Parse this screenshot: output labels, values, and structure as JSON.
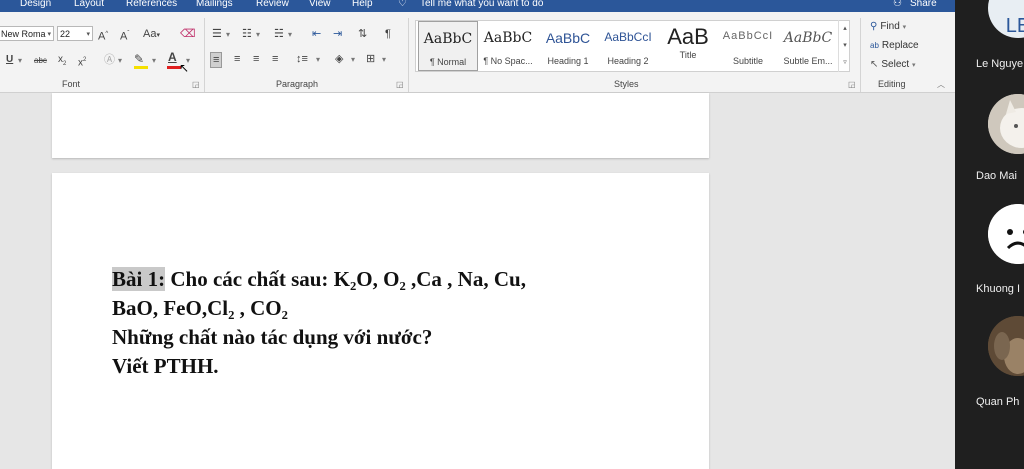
{
  "menu": [
    "Design",
    "Layout",
    "References",
    "Mailings",
    "Review",
    "View",
    "Help"
  ],
  "tell_me": "Tell me what you want to do",
  "share": "Share",
  "font": {
    "name": "New Roma",
    "size": "22",
    "group_label": "Font"
  },
  "paragraph": {
    "group_label": "Paragraph"
  },
  "styles": {
    "group_label": "Styles",
    "items": [
      {
        "preview": "AaBbC",
        "name": "¶ Normal"
      },
      {
        "preview": "AaBbC",
        "name": "¶ No Spac..."
      },
      {
        "preview": "AaBbC",
        "name": "Heading 1"
      },
      {
        "preview": "AaBbCcI",
        "name": "Heading 2"
      },
      {
        "preview": "AaB",
        "name": "Title"
      },
      {
        "preview": "AaBbCcI",
        "name": "Subtitle"
      },
      {
        "preview": "AaBbC",
        "name": "Subtle Em..."
      }
    ]
  },
  "editing": {
    "find": "Find",
    "replace": "Replace",
    "select": "Select",
    "group_label": "Editing"
  },
  "document": {
    "line1_label": "Bài 1:",
    "line1_text": " Cho các chất sau: K₂O, O₂ ,Ca , Na, Cu,",
    "line2": "BaO, FeO,Cl₂ , CO₂",
    "line3": "Những chất nào tác dụng với nước?",
    "line4": "Viết PTHH."
  },
  "participants": [
    {
      "initials": "LE",
      "name": "Le Nguye"
    },
    {
      "name": "Dao Mai"
    },
    {
      "name": "Khuong I"
    },
    {
      "name": "Quan Ph"
    }
  ],
  "colors": {
    "accent": "#2b579a",
    "font_color_bar": "#e02020",
    "highlight_bar": "#f5e000"
  }
}
